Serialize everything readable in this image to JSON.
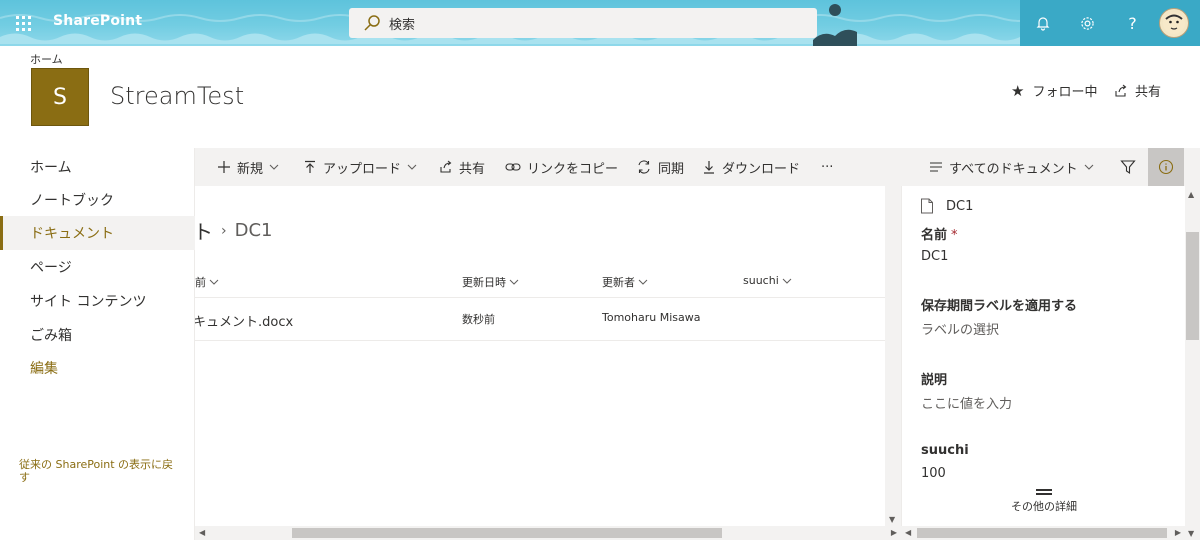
{
  "suite": {
    "brand": "SharePoint",
    "search_placeholder": "検索",
    "help_label": "?"
  },
  "site": {
    "breadcrumb": "ホーム",
    "logo_letter": "S",
    "title": "StreamTest",
    "follow_label": "フォロー中",
    "share_label": "共有"
  },
  "nav": {
    "items": [
      {
        "label": "ホーム"
      },
      {
        "label": "ノートブック"
      },
      {
        "label": "ドキュメント"
      },
      {
        "label": "ページ"
      },
      {
        "label": "サイト コンテンツ"
      },
      {
        "label": "ごみ箱"
      }
    ],
    "edit_label": "編集",
    "classic_label": "従来の SharePoint の表示に戻す"
  },
  "commands": {
    "new": "新規",
    "upload": "アップロード",
    "share": "共有",
    "copy_link": "リンクをコピー",
    "sync": "同期",
    "download": "ダウンロード",
    "more": "···",
    "view": "すべてのドキュメント"
  },
  "library": {
    "crumb_parent": "ト",
    "crumb_current": "DC1",
    "columns": [
      "前",
      "更新日時",
      "更新者",
      "suuchi"
    ],
    "rows": [
      {
        "name": "キュメント.docx",
        "modified": "数秒前",
        "modified_by": "Tomoharu Misawa",
        "suuchi": ""
      }
    ]
  },
  "details": {
    "file_name": "DC1",
    "name_label": "名前",
    "name_required": "*",
    "name_value": "DC1",
    "retention_label": "保存期間ラベルを適用する",
    "retention_value": "ラベルの選択",
    "description_label": "説明",
    "description_value": "ここに値を入力",
    "suuchi_label": "suuchi",
    "suuchi_value": "100",
    "more_details": "その他の詳細"
  },
  "colors": {
    "accent": "#8a6d13",
    "suitebar": "#5ec3dc",
    "suite_right": "#3aa9c6",
    "commandbar": "#f3f2f1"
  }
}
